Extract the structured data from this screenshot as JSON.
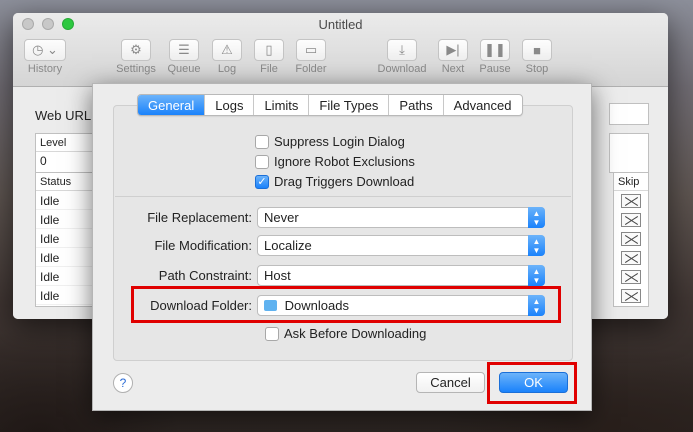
{
  "window": {
    "title": "Untitled"
  },
  "toolbar": {
    "history": "History",
    "settings": "Settings",
    "queue": "Queue",
    "log": "Log",
    "file": "File",
    "folder": "Folder",
    "download": "Download",
    "next": "Next",
    "pause": "Pause",
    "stop": "Stop"
  },
  "main": {
    "web_url_label": "Web URL:",
    "level_header": "Level",
    "level_value": "0",
    "status_header": "Status",
    "skip_header": "Skip",
    "status_rows": [
      "Idle",
      "Idle",
      "Idle",
      "Idle",
      "Idle",
      "Idle"
    ]
  },
  "dialog": {
    "tabs": [
      "General",
      "Logs",
      "Limits",
      "File Types",
      "Paths",
      "Advanced"
    ],
    "active_tab": "General",
    "checkboxes": {
      "suppress_login": {
        "label": "Suppress Login Dialog",
        "checked": false
      },
      "ignore_robot": {
        "label": "Ignore Robot Exclusions",
        "checked": false
      },
      "drag_triggers": {
        "label": "Drag Triggers Download",
        "checked": true
      },
      "ask_before": {
        "label": "Ask Before Downloading",
        "checked": false
      }
    },
    "fields": {
      "file_replacement": {
        "label": "File Replacement:",
        "value": "Never"
      },
      "file_modification": {
        "label": "File Modification:",
        "value": "Localize"
      },
      "path_constraint": {
        "label": "Path Constraint:",
        "value": "Host"
      },
      "download_folder": {
        "label": "Download Folder:",
        "value": "Downloads"
      }
    },
    "help_label": "?",
    "cancel_label": "Cancel",
    "ok_label": "OK"
  },
  "colors": {
    "accent": "#1a82fb",
    "highlight": "#e00000"
  }
}
